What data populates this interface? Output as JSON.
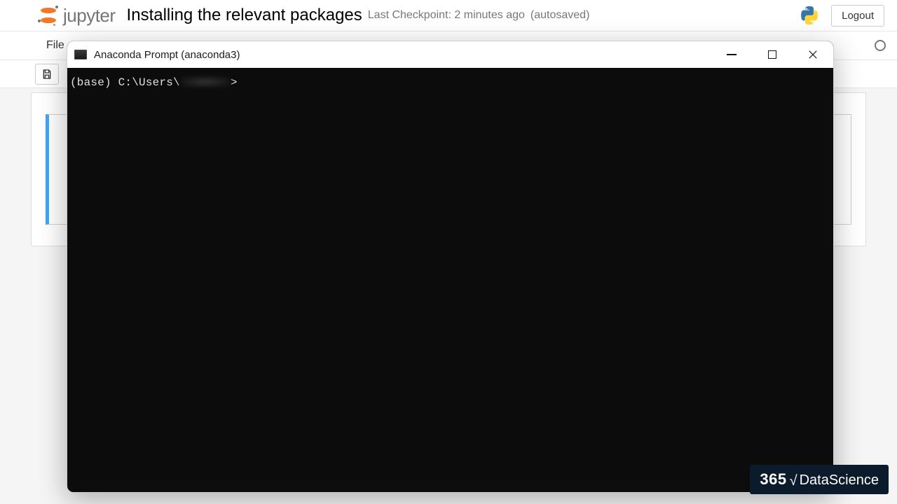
{
  "header": {
    "logo_text": "jupyter",
    "title": "Installing the relevant packages",
    "checkpoint": "Last Checkpoint: 2 minutes ago",
    "autosaved": "(autosaved)",
    "logout": "Logout"
  },
  "menubar": {
    "file": "File"
  },
  "terminal_window": {
    "title": "Anaconda Prompt (anaconda3)",
    "prompt_prefix": "(base) C:\\Users\\",
    "prompt_suffix": ">"
  },
  "badge": {
    "num": "365",
    "radical": "√",
    "label": "DataScience"
  }
}
